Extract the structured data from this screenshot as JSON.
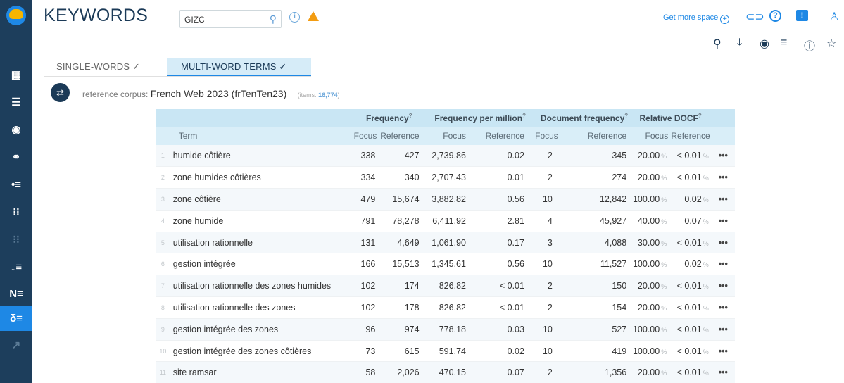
{
  "app": {
    "title": "KEYWORDS"
  },
  "search": {
    "value": "GIZC",
    "placeholder": ""
  },
  "header": {
    "get_more_space": "Get more space"
  },
  "tabs": [
    {
      "label": "SINGLE-WORDS ✓"
    },
    {
      "label": "MULTI-WORD TERMS ✓"
    }
  ],
  "corpus": {
    "label": "reference corpus:",
    "name": "French Web 2023 (frTenTen23)",
    "items_label": "(items:",
    "items_count": "16,774",
    "items_close": ")"
  },
  "sidebar": {
    "icons": [
      "dashboard-icon",
      "list-icon",
      "target-icon",
      "cluster-icon",
      "bullet-list-icon",
      "parallel-list-icon",
      "parallel-list-dim-icon",
      "sort-list-icon",
      "ngram-icon",
      "keywords-icon",
      "trends-icon"
    ]
  },
  "table": {
    "group_headers": [
      "Frequency",
      "Frequency per million",
      "Document frequency",
      "Relative DOCF"
    ],
    "help_mark": "?",
    "sub_headers": {
      "term": "Term",
      "focus": "Focus",
      "reference": "Reference"
    },
    "rows": [
      {
        "n": "1",
        "term": "humide côtière",
        "freq_f": "338",
        "freq_r": "427",
        "fpm_f": "2,739.86",
        "fpm_r": "0.02",
        "doc_f": "2",
        "doc_r": "345",
        "rd_f": "20.00",
        "rd_r": "< 0.01"
      },
      {
        "n": "2",
        "term": "zone humides côtières",
        "freq_f": "334",
        "freq_r": "340",
        "fpm_f": "2,707.43",
        "fpm_r": "0.01",
        "doc_f": "2",
        "doc_r": "274",
        "rd_f": "20.00",
        "rd_r": "< 0.01"
      },
      {
        "n": "3",
        "term": "zone côtière",
        "freq_f": "479",
        "freq_r": "15,674",
        "fpm_f": "3,882.82",
        "fpm_r": "0.56",
        "doc_f": "10",
        "doc_r": "12,842",
        "rd_f": "100.00",
        "rd_r": "0.02"
      },
      {
        "n": "4",
        "term": "zone humide",
        "freq_f": "791",
        "freq_r": "78,278",
        "fpm_f": "6,411.92",
        "fpm_r": "2.81",
        "doc_f": "4",
        "doc_r": "45,927",
        "rd_f": "40.00",
        "rd_r": "0.07"
      },
      {
        "n": "5",
        "term": "utilisation rationnelle",
        "freq_f": "131",
        "freq_r": "4,649",
        "fpm_f": "1,061.90",
        "fpm_r": "0.17",
        "doc_f": "3",
        "doc_r": "4,088",
        "rd_f": "30.00",
        "rd_r": "< 0.01"
      },
      {
        "n": "6",
        "term": "gestion intégrée",
        "freq_f": "166",
        "freq_r": "15,513",
        "fpm_f": "1,345.61",
        "fpm_r": "0.56",
        "doc_f": "10",
        "doc_r": "11,527",
        "rd_f": "100.00",
        "rd_r": "0.02"
      },
      {
        "n": "7",
        "term": "utilisation rationnelle des zones humides",
        "freq_f": "102",
        "freq_r": "174",
        "fpm_f": "826.82",
        "fpm_r": "< 0.01",
        "doc_f": "2",
        "doc_r": "150",
        "rd_f": "20.00",
        "rd_r": "< 0.01"
      },
      {
        "n": "8",
        "term": "utilisation rationnelle des zones",
        "freq_f": "102",
        "freq_r": "178",
        "fpm_f": "826.82",
        "fpm_r": "< 0.01",
        "doc_f": "2",
        "doc_r": "154",
        "rd_f": "20.00",
        "rd_r": "< 0.01"
      },
      {
        "n": "9",
        "term": "gestion intégrée des zones",
        "freq_f": "96",
        "freq_r": "974",
        "fpm_f": "778.18",
        "fpm_r": "0.03",
        "doc_f": "10",
        "doc_r": "527",
        "rd_f": "100.00",
        "rd_r": "< 0.01"
      },
      {
        "n": "10",
        "term": "gestion intégrée des zones côtières",
        "freq_f": "73",
        "freq_r": "615",
        "fpm_f": "591.74",
        "fpm_r": "0.02",
        "doc_f": "10",
        "doc_r": "419",
        "rd_f": "100.00",
        "rd_r": "< 0.01"
      },
      {
        "n": "11",
        "term": "site ramsar",
        "freq_f": "58",
        "freq_r": "2,026",
        "fpm_f": "470.15",
        "fpm_r": "0.07",
        "doc_f": "2",
        "doc_r": "1,356",
        "rd_f": "20.00",
        "rd_r": "< 0.01"
      }
    ],
    "percent_sign": "%",
    "more_glyph": "•••"
  },
  "colors": {
    "sidebar": "#1d3e5c",
    "accent": "#1e88e5",
    "warning": "#f39c12",
    "header_band": "#c9e6f4"
  }
}
